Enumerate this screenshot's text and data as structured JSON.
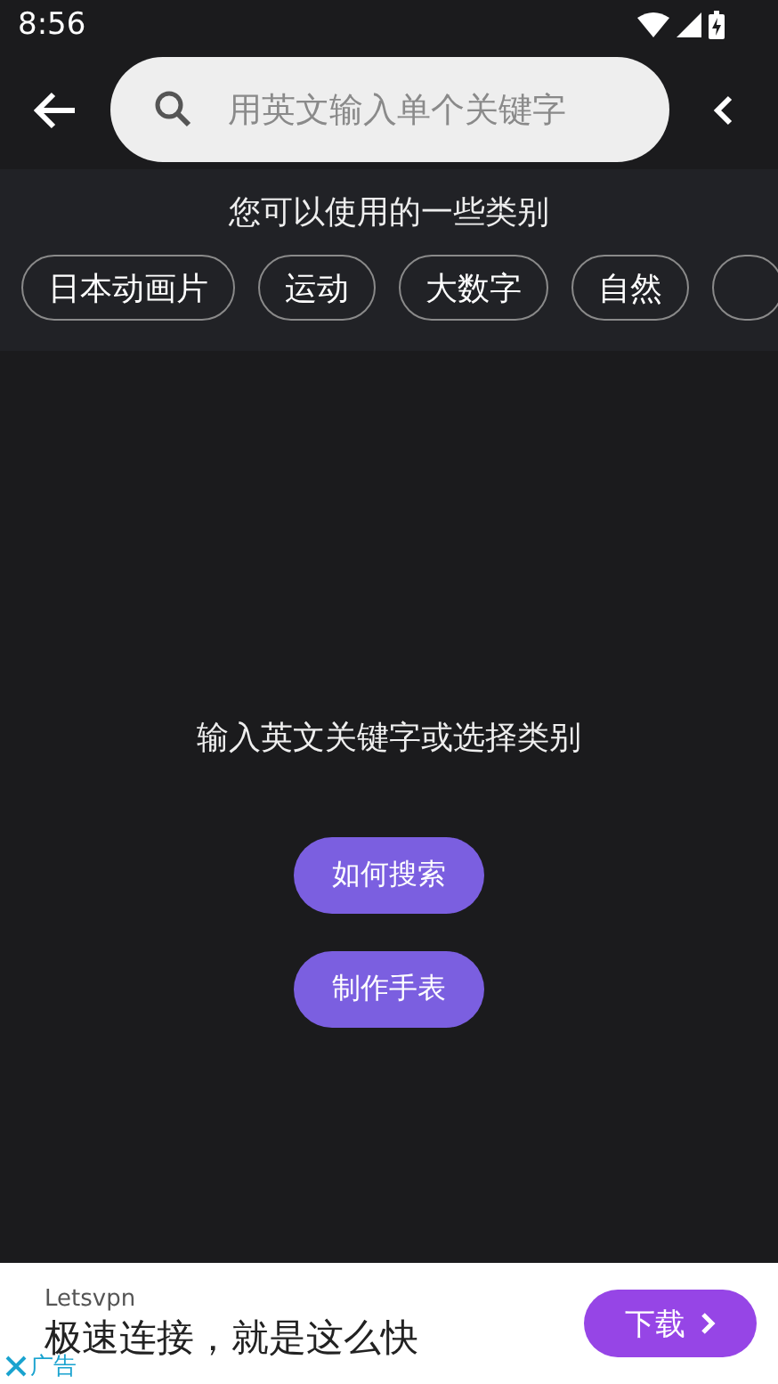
{
  "status_bar": {
    "time": "8:56"
  },
  "search": {
    "placeholder": "用英文输入单个关键字"
  },
  "categories": {
    "title": "您可以使用的一些类别",
    "chips": [
      {
        "label": "日本动画片"
      },
      {
        "label": "运动"
      },
      {
        "label": "大数字"
      },
      {
        "label": "自然"
      }
    ]
  },
  "main": {
    "message": "输入英文关键字或选择类别",
    "buttons": [
      "如何搜索",
      "制作手表"
    ]
  },
  "ad": {
    "advertiser": "Letsvpn",
    "headline": "极速连接，就是这么快",
    "cta": "下载",
    "label": "广告"
  }
}
